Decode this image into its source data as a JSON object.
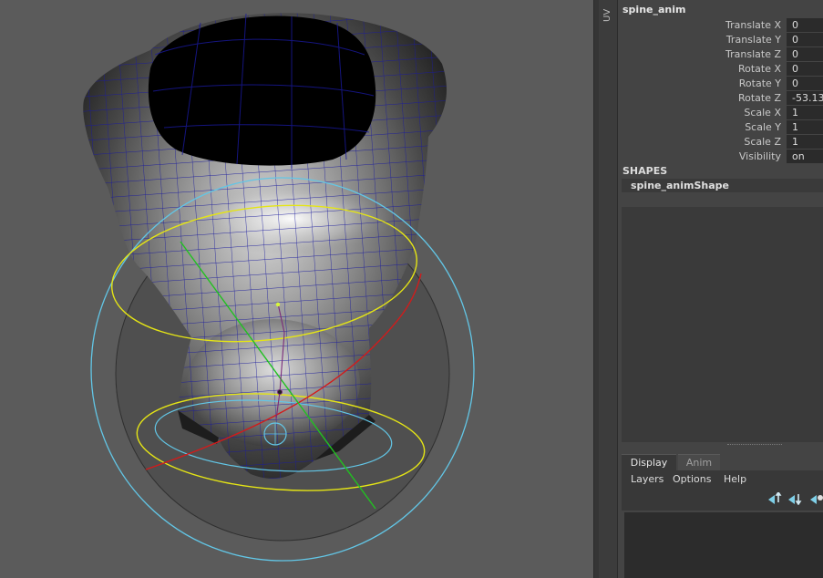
{
  "viewport": {
    "background": "#5b5b5b",
    "colors": {
      "wire": "#1a1a9e",
      "yellow_control": "#e5e515",
      "cyan_control": "#62c6e6",
      "red_axis": "#d21b1b",
      "green_axis": "#21c121"
    }
  },
  "uv_tab": {
    "label": "UV E"
  },
  "channel_box": {
    "node_name": "spine_anim",
    "attributes": [
      {
        "label": "Translate X",
        "value": "0"
      },
      {
        "label": "Translate Y",
        "value": "0"
      },
      {
        "label": "Translate Z",
        "value": "0"
      },
      {
        "label": "Rotate X",
        "value": "0"
      },
      {
        "label": "Rotate Y",
        "value": "0"
      },
      {
        "label": "Rotate Z",
        "value": "-53.13"
      },
      {
        "label": "Scale X",
        "value": "1"
      },
      {
        "label": "Scale Y",
        "value": "1"
      },
      {
        "label": "Scale Z",
        "value": "1"
      },
      {
        "label": "Visibility",
        "value": "on"
      }
    ],
    "shapes_header": "SHAPES",
    "shape_name": "spine_animShape"
  },
  "layer_editor": {
    "tabs": [
      {
        "label": "Display",
        "active": true
      },
      {
        "label": "Anim",
        "active": false
      }
    ],
    "menus": [
      "Layers",
      "Options",
      "Help"
    ],
    "icons": [
      "move-layer-up-icon",
      "move-layer-down-icon",
      "new-layer-icon"
    ]
  }
}
